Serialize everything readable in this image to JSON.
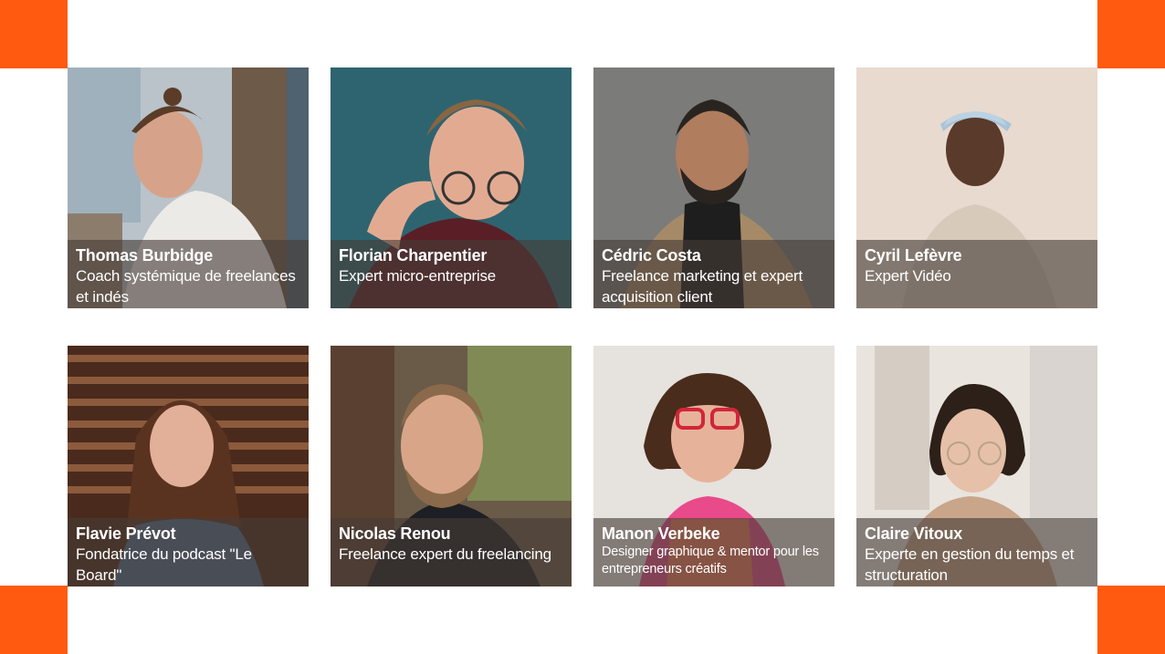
{
  "accent_color": "#ff5a0f",
  "team": [
    {
      "name": "Thomas Burbidge",
      "role": "Coach systémique de freelances et indés"
    },
    {
      "name": "Florian Charpentier",
      "role": "Expert micro-entreprise"
    },
    {
      "name": "Cédric Costa",
      "role": "Freelance marketing et expert acquisition client"
    },
    {
      "name": "Cyril Lefèvre",
      "role": "Expert Vidéo"
    },
    {
      "name": "Flavie Prévot",
      "role": "Fondatrice du podcast \"Le Board\""
    },
    {
      "name": "Nicolas Renou",
      "role": "Freelance expert du freelancing"
    },
    {
      "name": "Manon Verbeke",
      "role": "Designer graphique & mentor pour les entrepreneurs créatifs"
    },
    {
      "name": "Claire Vitoux",
      "role": "Experte en gestion du temps et structuration"
    }
  ]
}
